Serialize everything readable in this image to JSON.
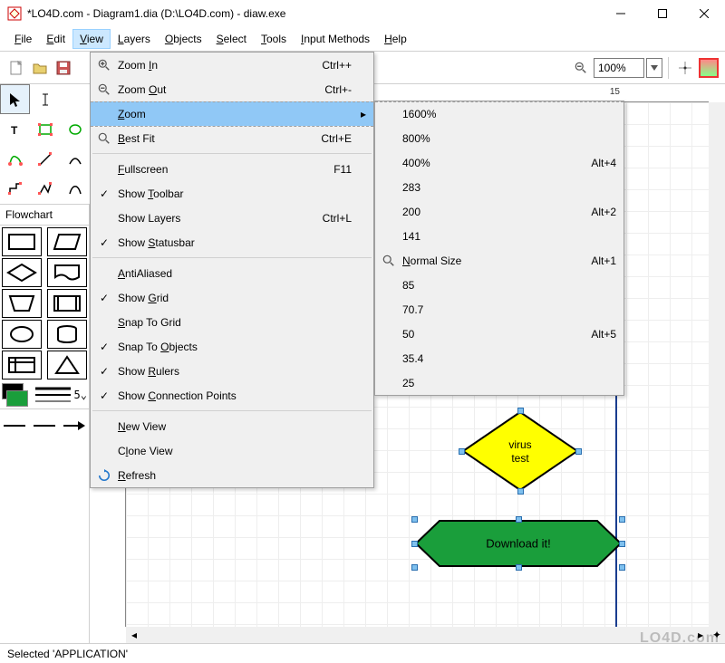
{
  "titlebar": {
    "title": "*LO4D.com - Diagram1.dia (D:\\LO4D.com) - diaw.exe"
  },
  "menubar": {
    "items": [
      "File",
      "Edit",
      "View",
      "Layers",
      "Objects",
      "Select",
      "Tools",
      "Input Methods",
      "Help"
    ],
    "active_index": 2
  },
  "toolbar": {
    "zoom_value": "100%"
  },
  "left_panel": {
    "shape_set_label": "Flowchart"
  },
  "view_menu": {
    "items": [
      {
        "icon": "zoom-in",
        "label": "Zoom In",
        "accel": "Ctrl++",
        "check": false
      },
      {
        "icon": "zoom-out",
        "label": "Zoom Out",
        "accel": "Ctrl+-",
        "check": false
      },
      {
        "icon": "",
        "label": "Zoom",
        "accel": "",
        "submenu": true,
        "highlight": true,
        "dashed": true
      },
      {
        "icon": "zoom-fit",
        "label": "Best Fit",
        "accel": "Ctrl+E",
        "check": false
      },
      {
        "sep": true
      },
      {
        "label": "Fullscreen",
        "accel": "F11",
        "check": false
      },
      {
        "label": "Show Toolbar",
        "accel": "",
        "check": true
      },
      {
        "label": "Show Layers",
        "accel": "Ctrl+L",
        "check": false
      },
      {
        "label": "Show Statusbar",
        "accel": "",
        "check": true
      },
      {
        "sep": true
      },
      {
        "label": "AntiAliased",
        "accel": "",
        "check": false
      },
      {
        "label": "Show Grid",
        "accel": "",
        "check": true
      },
      {
        "label": "Snap To Grid",
        "accel": "",
        "check": false
      },
      {
        "label": "Snap To Objects",
        "accel": "",
        "check": true
      },
      {
        "label": "Show Rulers",
        "accel": "",
        "check": true
      },
      {
        "label": "Show Connection Points",
        "accel": "",
        "check": true
      },
      {
        "sep": true
      },
      {
        "label": "New View",
        "accel": "",
        "check": false
      },
      {
        "label": "Clone View",
        "accel": "",
        "check": false
      },
      {
        "icon": "refresh",
        "label": "Refresh",
        "accel": "",
        "check": false
      }
    ]
  },
  "zoom_submenu": {
    "items": [
      {
        "label": "1600%",
        "accel": ""
      },
      {
        "label": "800%",
        "accel": ""
      },
      {
        "label": "400%",
        "accel": "Alt+4"
      },
      {
        "label": "283",
        "accel": ""
      },
      {
        "label": "200",
        "accel": "Alt+2"
      },
      {
        "label": "141",
        "accel": ""
      },
      {
        "label": "Normal Size",
        "accel": "Alt+1",
        "icon": "zoom-100"
      },
      {
        "label": "85",
        "accel": ""
      },
      {
        "label": "70.7",
        "accel": ""
      },
      {
        "label": "50",
        "accel": "Alt+5"
      },
      {
        "label": "35.4",
        "accel": ""
      },
      {
        "label": "25",
        "accel": ""
      }
    ]
  },
  "canvas": {
    "diamond_text_1": "virus",
    "diamond_text_2": "test",
    "hexagon_text": "Download it!",
    "ruler_tick": "15"
  },
  "statusbar": {
    "text": "Selected 'APPLICATION'"
  },
  "watermark": "LO4D.com"
}
